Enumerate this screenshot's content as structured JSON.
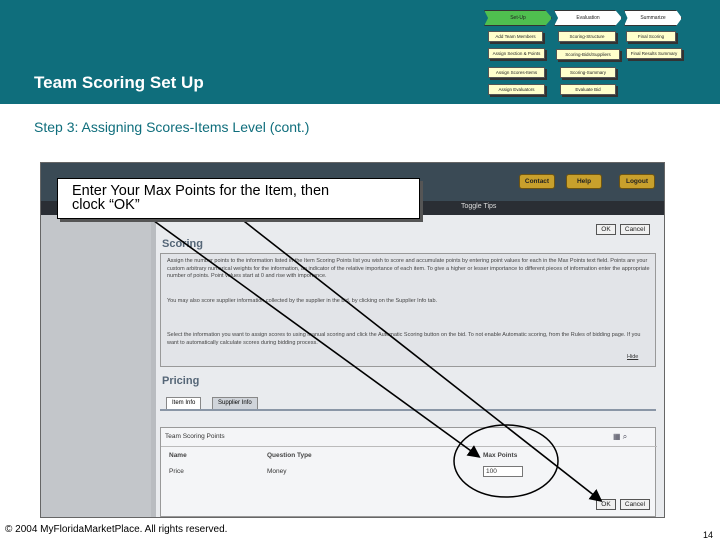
{
  "header": {
    "title": "Team Scoring Set Up"
  },
  "process_flow": {
    "phases": [
      "Set-Up",
      "Evaluation",
      "Summarize"
    ],
    "setup_steps": [
      "Add Team Members",
      "Assign Section & Points",
      "Assign Scores-Items",
      "Assign Evaluators"
    ],
    "evaluation_steps": [
      "Scoring-Structure",
      "Scoring-Bids/Suppliers",
      "Scoring-Summary",
      "Evaluate Bid"
    ],
    "summarize_steps": [
      "Final Scoring",
      "Final Results Summary"
    ]
  },
  "step_title": "Step 3: Assigning Scores-Items Level (cont.)",
  "callout": {
    "text": "Enter Your Max Points for the Item, then\nclock “OK”"
  },
  "screenshot": {
    "top_buttons": [
      "Contact",
      "Help",
      "Logout"
    ],
    "toggle_tips": "Toggle Tips",
    "ok_label": "OK",
    "cancel_label": "Cancel",
    "scoring_heading": "Scoring",
    "scoring_text_1": "Assign the number points to the information listed in the Item Scoring Points list you wish to score and accumulate points by entering point values for each in the Max Points text field. Points are your custom arbitrary numerical weights for the information, an indicator of the relative importance of each item. To give a higher or lesser importance to different pieces of information enter the appropriate number of points. Point values start at 0 and rise with importance.",
    "scoring_text_2": "You may also score supplier information collected by the supplier in the bid, by clicking on the Supplier Info tab.",
    "supplier_info_link": "Supplier Info",
    "scoring_text_3": "Select the information you want to assign scores to using manual scoring and click the Automatic Scoring button on the bid. To not enable Automatic scoring, from the Rules of bidding page. If you want to automatically calculate scores during bidding process.",
    "hide_link": "Hide",
    "pricing_heading": "Pricing",
    "tabs": [
      "Item Info",
      "Supplier Info"
    ],
    "team_scoring_points": "Team Scoring Points",
    "columns": [
      "Name",
      "Question Type",
      "Max Points"
    ],
    "rows": [
      {
        "name": "Price",
        "type": "Money",
        "max_points": "100"
      }
    ]
  },
  "footer": {
    "copyright": "© 2004 MyFloridaMarketPlace. All rights reserved.",
    "page_number": "14"
  },
  "colors": {
    "header_bg": "#0f6e7c",
    "setup_phase": "#4fbf4f",
    "step_box": "#ffffcc",
    "button_gold": "#c8a02c"
  }
}
